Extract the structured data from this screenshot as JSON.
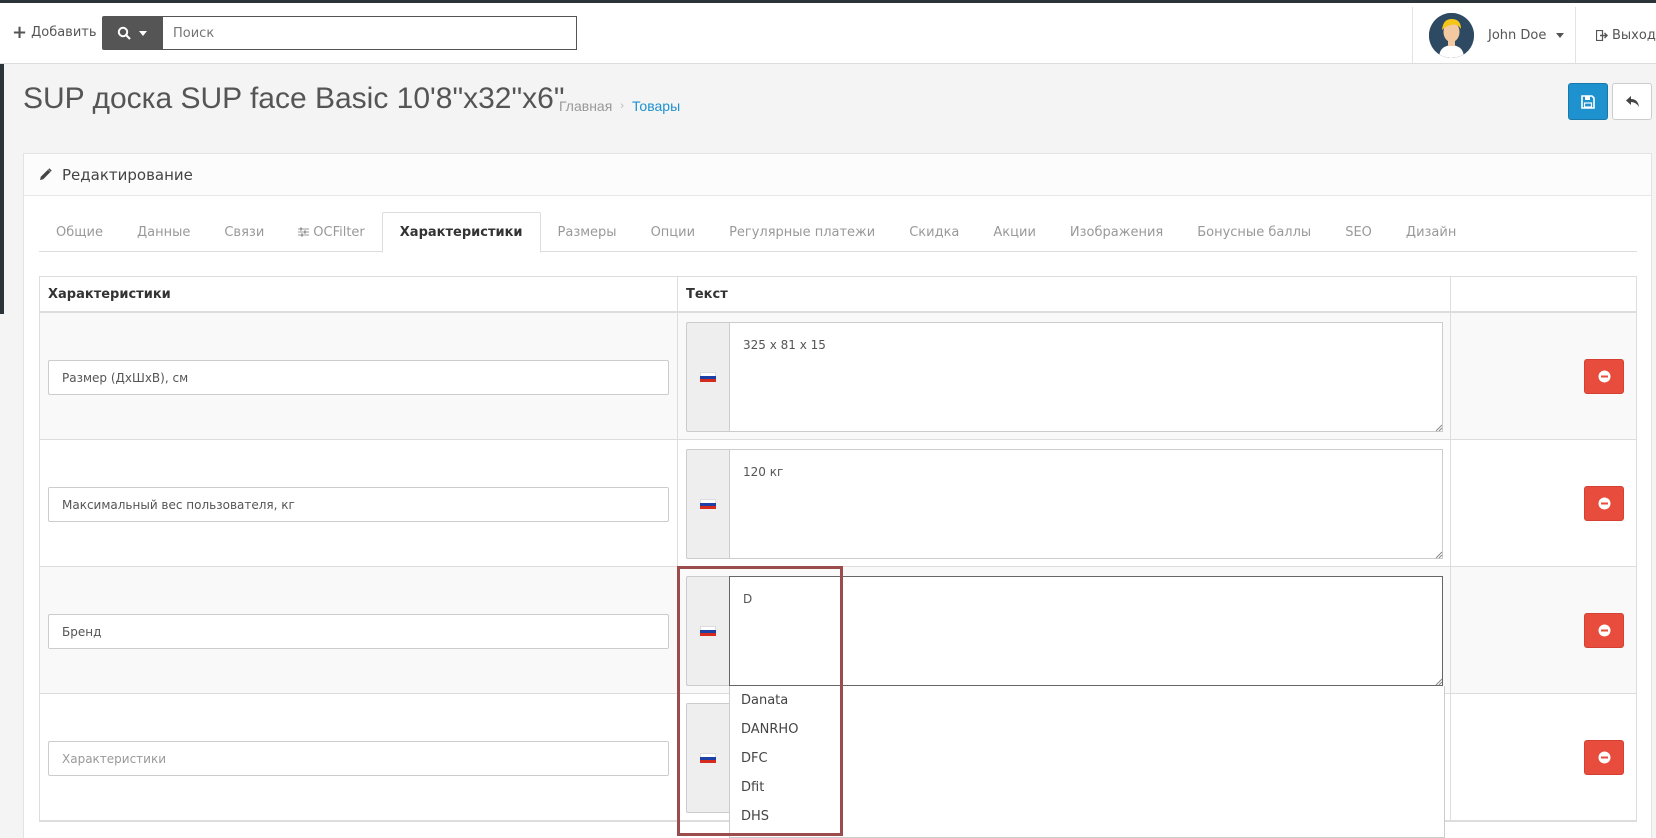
{
  "header": {
    "add_label": "Добавить",
    "search": {
      "placeholder": "Поиск"
    },
    "user_name": "John Doe",
    "logout_label": "Выход"
  },
  "page": {
    "title": "SUP доска SUP face Basic 10'8\"x32\"x6\"",
    "breadcrumb": {
      "home": "Главная",
      "current": "Товары"
    }
  },
  "panel": {
    "heading": "Редактирование",
    "tabs": [
      {
        "label": "Общие"
      },
      {
        "label": "Данные"
      },
      {
        "label": "Связи"
      },
      {
        "label": "OCFilter"
      },
      {
        "label": "Характеристики"
      },
      {
        "label": "Размеры"
      },
      {
        "label": "Опции"
      },
      {
        "label": "Регулярные платежи"
      },
      {
        "label": "Скидка"
      },
      {
        "label": "Акции"
      },
      {
        "label": "Изображения"
      },
      {
        "label": "Бонусные баллы"
      },
      {
        "label": "SEO"
      },
      {
        "label": "Дизайн"
      }
    ],
    "active_tab": "Характеристики"
  },
  "table": {
    "col_attr": "Характеристики",
    "col_text": "Текст",
    "rows": [
      {
        "attribute": "Размер (ДхШхВ), см",
        "text": "325 х 81 х 15"
      },
      {
        "attribute": "Максимальный вес пользователя, кг",
        "text": "120 кг"
      },
      {
        "attribute": "Бренд",
        "text": "D"
      },
      {
        "attribute": "",
        "attribute_placeholder": "Характеристики",
        "text": ""
      }
    ]
  },
  "autocomplete": {
    "items": [
      "Danata",
      "DANRHO",
      "DFC",
      "Dfit",
      "DHS"
    ]
  },
  "colors": {
    "primary": "#1e91cf",
    "danger": "#e74c3c",
    "highlight": "#9b4c4c",
    "header_bar": "#2a3439"
  }
}
